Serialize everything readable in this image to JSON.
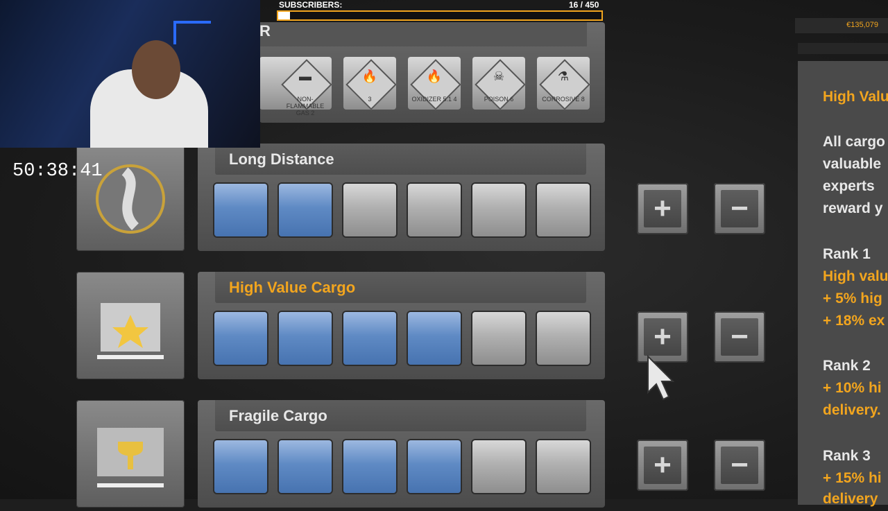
{
  "stream": {
    "subscribers_label": "SUBSCRIBERS:",
    "subscribers_count": "16  / 450",
    "subscribers_progress": 0.0356,
    "timer": "50:38:41"
  },
  "money": "€135,079",
  "hazmat": {
    "title_fragment": "R",
    "icons": [
      {
        "name": "partial-hazard-icon",
        "symbol": "",
        "num": ""
      },
      {
        "name": "non-flammable-gas-icon",
        "symbol": "▬",
        "num": "NON-FLAMMABLE GAS 2"
      },
      {
        "name": "flammable-icon",
        "symbol": "🔥",
        "num": "3"
      },
      {
        "name": "oxidizer-icon",
        "symbol": "🔥",
        "num": "OXIDIZER 5.1 4"
      },
      {
        "name": "poison-icon",
        "symbol": "☠",
        "num": "POISON 6"
      },
      {
        "name": "corrosive-icon",
        "symbol": "⚗",
        "num": "CORROSIVE 8"
      }
    ]
  },
  "skills": [
    {
      "key": "long-distance",
      "title": "Long Distance",
      "gold": false,
      "level": 2,
      "max": 6
    },
    {
      "key": "high-value-cargo",
      "title": "High Value Cargo",
      "gold": true,
      "level": 4,
      "max": 6
    },
    {
      "key": "fragile-cargo",
      "title": "Fragile Cargo",
      "gold": false,
      "level": 4,
      "max": 6
    }
  ],
  "buttons": {
    "plus": "+",
    "minus": "−"
  },
  "info": {
    "title": "High Valu",
    "desc_1": "All cargo",
    "desc_2": "valuable",
    "desc_3": "experts",
    "desc_4": "reward y",
    "rank1": "Rank 1",
    "rank1_a": "High valu",
    "rank1_b": "+ 5% hig",
    "rank1_c": "+ 18% ex",
    "rank2": "Rank 2",
    "rank2_a": "+ 10% hi",
    "rank2_b": "delivery.",
    "rank3": "Rank 3",
    "rank3_a": "+ 15% hi",
    "rank3_b": "delivery"
  },
  "colors": {
    "accent": "#f2a51e",
    "slot_on": "#5f8ac4",
    "slot_off": "#b0b0b0"
  }
}
